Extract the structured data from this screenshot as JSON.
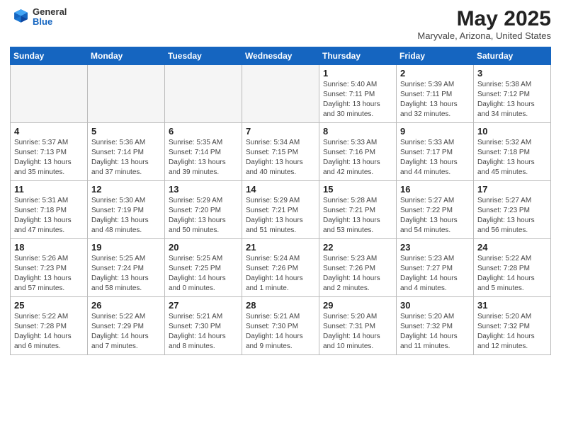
{
  "header": {
    "logo_general": "General",
    "logo_blue": "Blue",
    "month": "May 2025",
    "location": "Maryvale, Arizona, United States"
  },
  "weekdays": [
    "Sunday",
    "Monday",
    "Tuesday",
    "Wednesday",
    "Thursday",
    "Friday",
    "Saturday"
  ],
  "weeks": [
    [
      {
        "day": "",
        "info": ""
      },
      {
        "day": "",
        "info": ""
      },
      {
        "day": "",
        "info": ""
      },
      {
        "day": "",
        "info": ""
      },
      {
        "day": "1",
        "info": "Sunrise: 5:40 AM\nSunset: 7:11 PM\nDaylight: 13 hours\nand 30 minutes."
      },
      {
        "day": "2",
        "info": "Sunrise: 5:39 AM\nSunset: 7:11 PM\nDaylight: 13 hours\nand 32 minutes."
      },
      {
        "day": "3",
        "info": "Sunrise: 5:38 AM\nSunset: 7:12 PM\nDaylight: 13 hours\nand 34 minutes."
      }
    ],
    [
      {
        "day": "4",
        "info": "Sunrise: 5:37 AM\nSunset: 7:13 PM\nDaylight: 13 hours\nand 35 minutes."
      },
      {
        "day": "5",
        "info": "Sunrise: 5:36 AM\nSunset: 7:14 PM\nDaylight: 13 hours\nand 37 minutes."
      },
      {
        "day": "6",
        "info": "Sunrise: 5:35 AM\nSunset: 7:14 PM\nDaylight: 13 hours\nand 39 minutes."
      },
      {
        "day": "7",
        "info": "Sunrise: 5:34 AM\nSunset: 7:15 PM\nDaylight: 13 hours\nand 40 minutes."
      },
      {
        "day": "8",
        "info": "Sunrise: 5:33 AM\nSunset: 7:16 PM\nDaylight: 13 hours\nand 42 minutes."
      },
      {
        "day": "9",
        "info": "Sunrise: 5:33 AM\nSunset: 7:17 PM\nDaylight: 13 hours\nand 44 minutes."
      },
      {
        "day": "10",
        "info": "Sunrise: 5:32 AM\nSunset: 7:18 PM\nDaylight: 13 hours\nand 45 minutes."
      }
    ],
    [
      {
        "day": "11",
        "info": "Sunrise: 5:31 AM\nSunset: 7:18 PM\nDaylight: 13 hours\nand 47 minutes."
      },
      {
        "day": "12",
        "info": "Sunrise: 5:30 AM\nSunset: 7:19 PM\nDaylight: 13 hours\nand 48 minutes."
      },
      {
        "day": "13",
        "info": "Sunrise: 5:29 AM\nSunset: 7:20 PM\nDaylight: 13 hours\nand 50 minutes."
      },
      {
        "day": "14",
        "info": "Sunrise: 5:29 AM\nSunset: 7:21 PM\nDaylight: 13 hours\nand 51 minutes."
      },
      {
        "day": "15",
        "info": "Sunrise: 5:28 AM\nSunset: 7:21 PM\nDaylight: 13 hours\nand 53 minutes."
      },
      {
        "day": "16",
        "info": "Sunrise: 5:27 AM\nSunset: 7:22 PM\nDaylight: 13 hours\nand 54 minutes."
      },
      {
        "day": "17",
        "info": "Sunrise: 5:27 AM\nSunset: 7:23 PM\nDaylight: 13 hours\nand 56 minutes."
      }
    ],
    [
      {
        "day": "18",
        "info": "Sunrise: 5:26 AM\nSunset: 7:23 PM\nDaylight: 13 hours\nand 57 minutes."
      },
      {
        "day": "19",
        "info": "Sunrise: 5:25 AM\nSunset: 7:24 PM\nDaylight: 13 hours\nand 58 minutes."
      },
      {
        "day": "20",
        "info": "Sunrise: 5:25 AM\nSunset: 7:25 PM\nDaylight: 14 hours\nand 0 minutes."
      },
      {
        "day": "21",
        "info": "Sunrise: 5:24 AM\nSunset: 7:26 PM\nDaylight: 14 hours\nand 1 minute."
      },
      {
        "day": "22",
        "info": "Sunrise: 5:23 AM\nSunset: 7:26 PM\nDaylight: 14 hours\nand 2 minutes."
      },
      {
        "day": "23",
        "info": "Sunrise: 5:23 AM\nSunset: 7:27 PM\nDaylight: 14 hours\nand 4 minutes."
      },
      {
        "day": "24",
        "info": "Sunrise: 5:22 AM\nSunset: 7:28 PM\nDaylight: 14 hours\nand 5 minutes."
      }
    ],
    [
      {
        "day": "25",
        "info": "Sunrise: 5:22 AM\nSunset: 7:28 PM\nDaylight: 14 hours\nand 6 minutes."
      },
      {
        "day": "26",
        "info": "Sunrise: 5:22 AM\nSunset: 7:29 PM\nDaylight: 14 hours\nand 7 minutes."
      },
      {
        "day": "27",
        "info": "Sunrise: 5:21 AM\nSunset: 7:30 PM\nDaylight: 14 hours\nand 8 minutes."
      },
      {
        "day": "28",
        "info": "Sunrise: 5:21 AM\nSunset: 7:30 PM\nDaylight: 14 hours\nand 9 minutes."
      },
      {
        "day": "29",
        "info": "Sunrise: 5:20 AM\nSunset: 7:31 PM\nDaylight: 14 hours\nand 10 minutes."
      },
      {
        "day": "30",
        "info": "Sunrise: 5:20 AM\nSunset: 7:32 PM\nDaylight: 14 hours\nand 11 minutes."
      },
      {
        "day": "31",
        "info": "Sunrise: 5:20 AM\nSunset: 7:32 PM\nDaylight: 14 hours\nand 12 minutes."
      }
    ]
  ]
}
